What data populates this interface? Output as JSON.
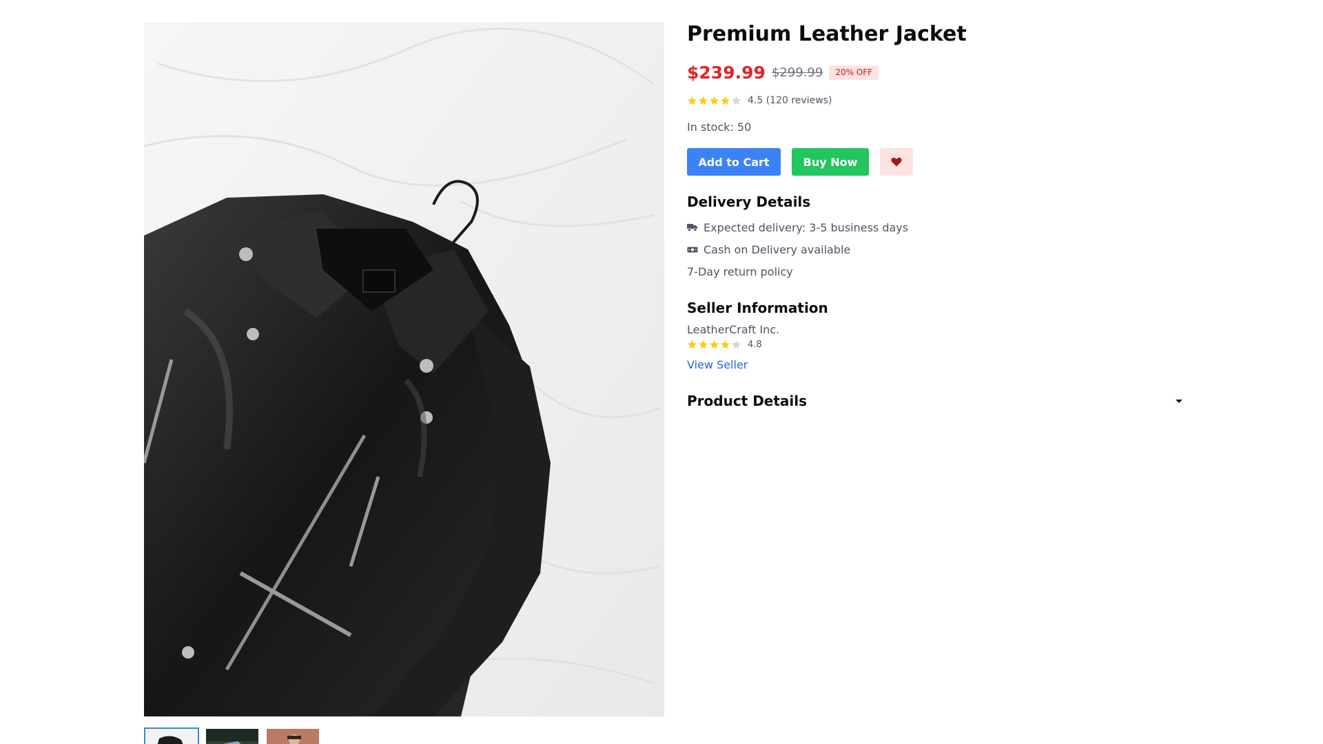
{
  "product": {
    "title": "Premium Leather Jacket",
    "price": "$239.99",
    "original_price": "$299.99",
    "discount": "20% OFF",
    "rating": 4.5,
    "rating_text": "4.5 (120 reviews)",
    "stock": "In stock: 50"
  },
  "gallery": {
    "main_image": "leather-jacket-on-white-sheet",
    "thumbnails": [
      {
        "image": "leather-jacket-thumbnail",
        "active": true
      },
      {
        "image": "jacket-outdoor-thumbnail",
        "active": false
      },
      {
        "image": "person-wearing-jacket-thumbnail",
        "active": false
      }
    ]
  },
  "actions": {
    "add_to_cart": "Add to Cart",
    "buy_now": "Buy Now",
    "wishlist_icon": "heart-icon"
  },
  "delivery": {
    "title": "Delivery Details",
    "items": [
      {
        "icon": "truck-icon",
        "text": "Expected delivery: 3-5 business days"
      },
      {
        "icon": "cash-icon",
        "text": "Cash on Delivery available"
      },
      {
        "icon": "",
        "text": "7-Day return policy"
      }
    ]
  },
  "seller": {
    "title": "Seller Information",
    "name": "LeatherCraft Inc.",
    "rating": 4.8,
    "rating_text": "4.8",
    "view_link": "View Seller"
  },
  "details": {
    "title": "Product Details",
    "expanded": false
  },
  "colors": {
    "price": "#dc2626",
    "primary_button": "#3b82f6",
    "buy_button": "#22c55e",
    "wishlist_bg": "#fee2e2",
    "wishlist_heart": "#991b1b",
    "star_filled": "#facc15",
    "star_empty": "#d1d5db",
    "link": "#2563eb"
  }
}
